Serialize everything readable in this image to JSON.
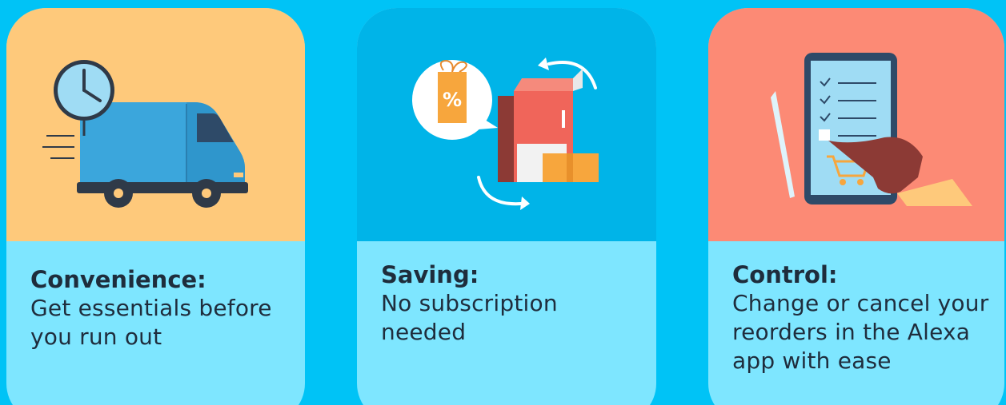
{
  "cards": [
    {
      "heading": "Convenience:",
      "lines": [
        "Get essentials before",
        "you run out"
      ],
      "icon": "delivery-van-clock-icon",
      "color": "#fec97b"
    },
    {
      "heading": "Saving:",
      "lines": [
        "No subscription",
        "needed"
      ],
      "icon": "discount-tag-box-icon",
      "badge_text": "%",
      "color": "#00b4e8"
    },
    {
      "heading": "Control:",
      "lines": [
        "Change or cancel your",
        "reorders in the Alexa",
        "app with ease"
      ],
      "icon": "tablet-checklist-cart-icon",
      "color": "#fc8a75"
    }
  ],
  "colors": {
    "background": "#00c3f6",
    "caption_panel": "#7ee6ff",
    "text": "#1e2d3c"
  }
}
